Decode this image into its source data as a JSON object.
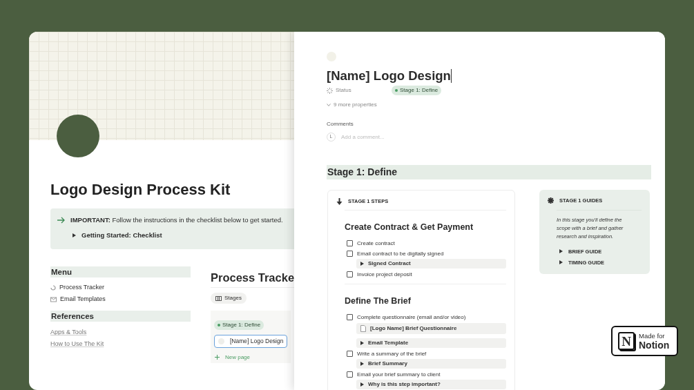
{
  "left_page": {
    "title": "Logo Design Process Kit",
    "callout": {
      "text": "**IMPORTANT:** Follow the instructions in the checklist below to get started.",
      "toggle": "Getting Started: Checklist"
    },
    "menu": {
      "heading": "Menu",
      "items": [
        {
          "kind": "tracker",
          "label": "Process Tracker"
        },
        {
          "kind": "email",
          "label": "Email Templates"
        }
      ]
    },
    "references": {
      "heading": "References",
      "items": [
        "Apps & Tools",
        "How to Use The Kit"
      ]
    },
    "process_tracker": {
      "title": "Process Tracke",
      "view_tab": "Stages",
      "group": "Stage 1: Define",
      "cards": [
        {
          "label": "[Name] Logo Design",
          "selected": true
        }
      ],
      "new_page": "New page"
    }
  },
  "page": {
    "title": "[Name] Logo Design",
    "properties": [
      {
        "label": "Status",
        "value": "Stage 1: Define"
      }
    ],
    "more_properties": "9 more properties",
    "comments": {
      "heading": "Comments",
      "avatar": "L",
      "placeholder": "Add a comment..."
    },
    "stage_heading": "Stage 1: Define",
    "steps": {
      "heading": "STAGE 1 STEPS",
      "sections": [
        {
          "title": "Create Contract & Get Payment",
          "items": [
            {
              "kind": "todo",
              "label": "Create contract",
              "checked": false
            },
            {
              "kind": "todo",
              "label": "Email contract to be digitally signed",
              "checked": false
            },
            {
              "kind": "toggle",
              "label": "Signed Contract"
            },
            {
              "kind": "todo",
              "label": "Invoice project deposit",
              "checked": false
            }
          ]
        },
        {
          "title": "Define The Brief",
          "items": [
            {
              "kind": "todo",
              "label": "Complete questionnaire (email and/or video)",
              "checked": false
            },
            {
              "kind": "page",
              "label": "[Logo Name] Brief Questionnaire"
            },
            {
              "kind": "toggle",
              "label": "Email Template"
            },
            {
              "kind": "todo",
              "label": "Write a summary of the brief",
              "checked": false
            },
            {
              "kind": "toggle",
              "label": "Brief Summary"
            },
            {
              "kind": "todo",
              "label": "Email your brief summary to client",
              "checked": false
            },
            {
              "kind": "toggle",
              "label": "Why is this step important?"
            }
          ]
        }
      ]
    },
    "guides": {
      "heading": "STAGE 1 GUIDES",
      "text": "In this stage you'll define the scope with a brief and gather research and inspiration.",
      "toggles": [
        "BRIEF GUIDE",
        "TIMING GUIDE"
      ]
    }
  },
  "badge": {
    "logo_letter": "N",
    "line1": "Made for",
    "line2": "Notion"
  }
}
